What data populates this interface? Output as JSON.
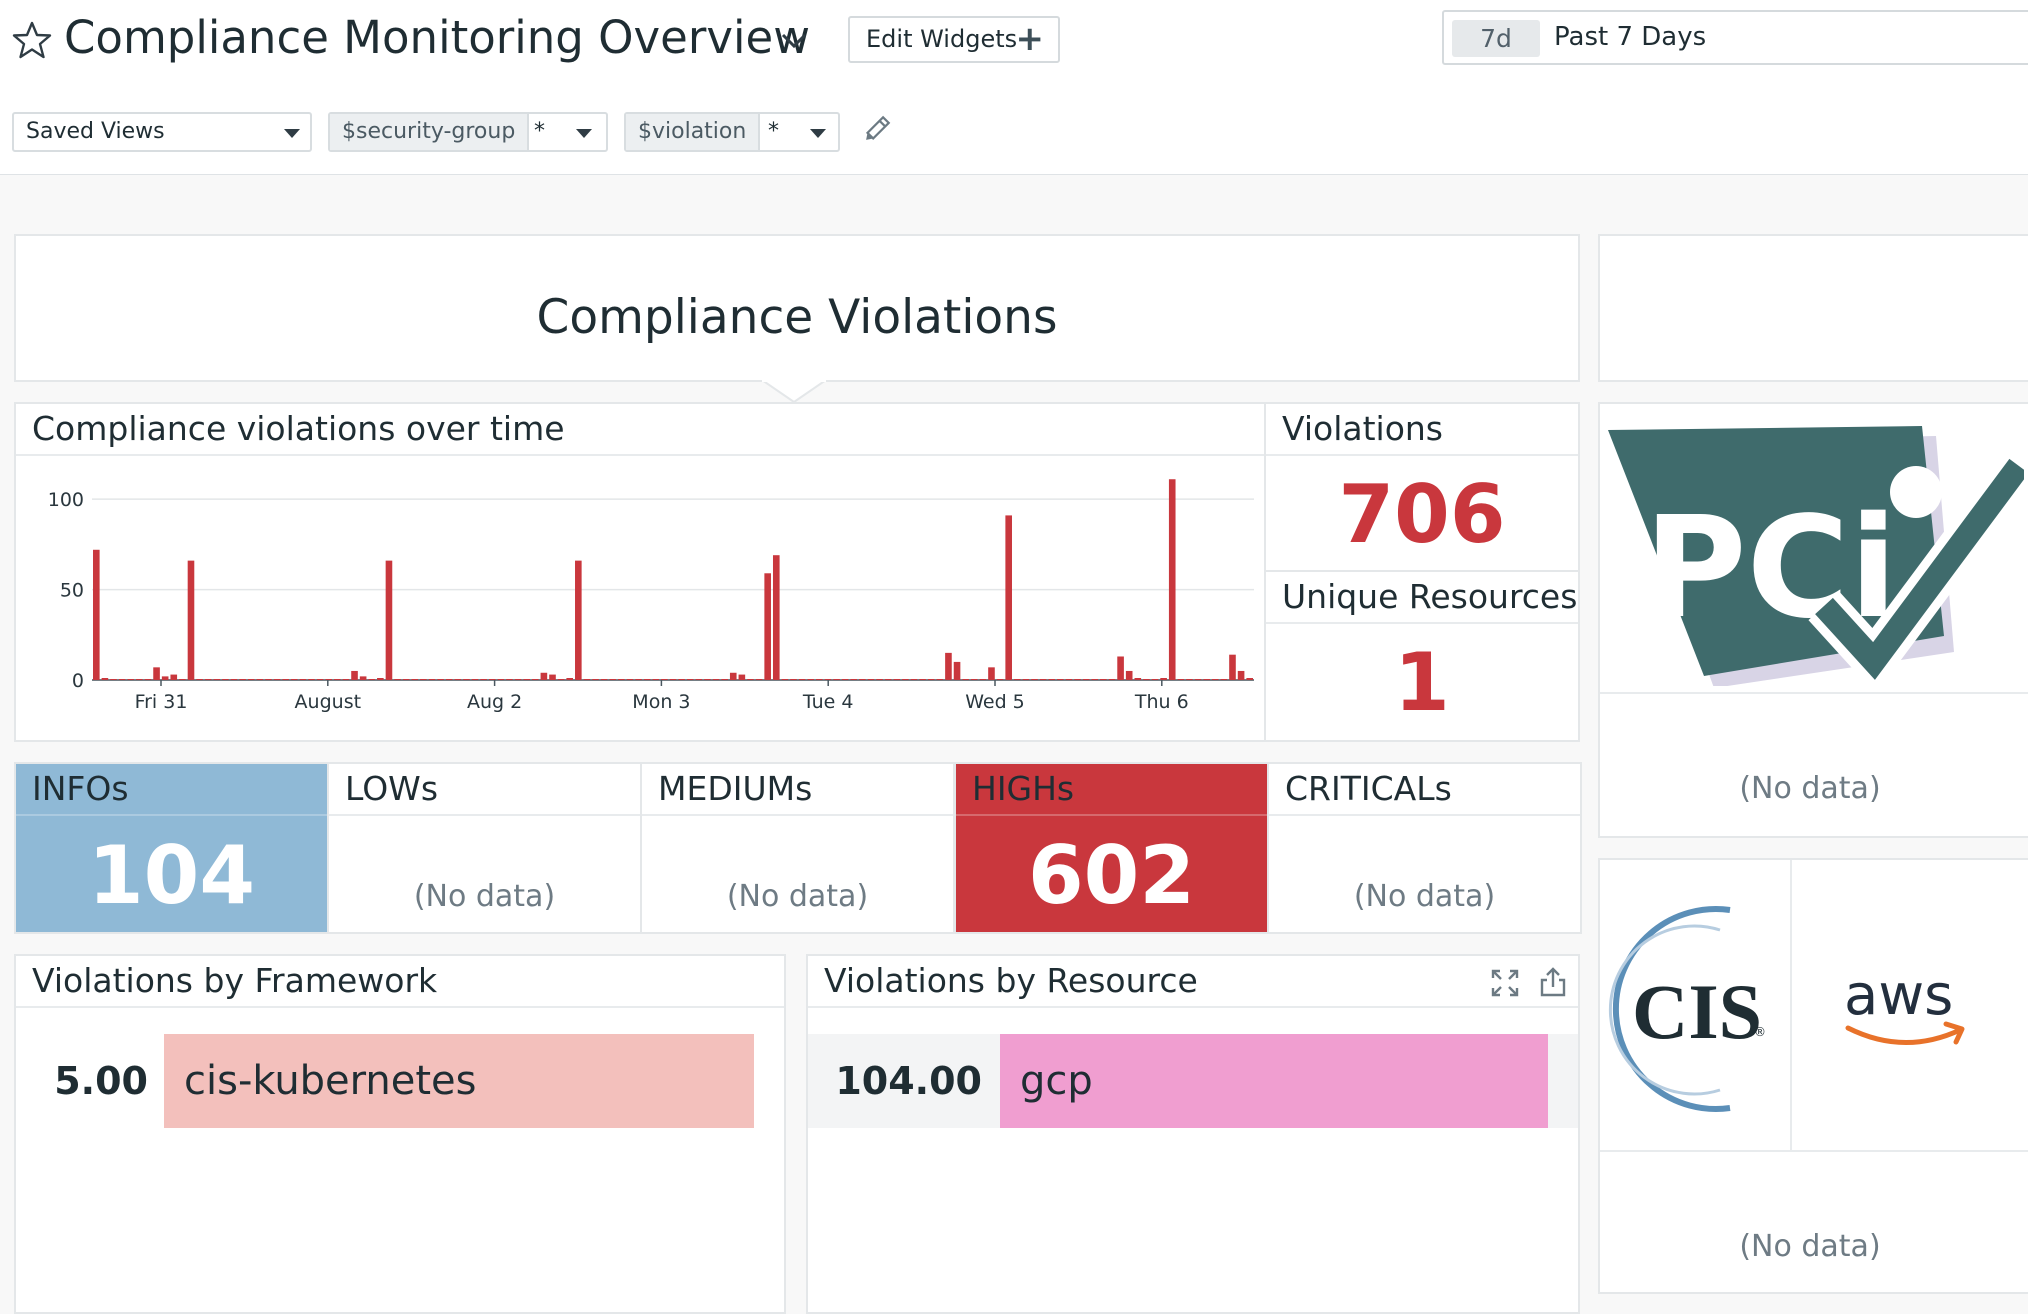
{
  "header": {
    "title": "Compliance Monitoring Overview",
    "edit_widgets": "Edit Widgets",
    "time_badge": "7d",
    "time_label": "Past 7 Days"
  },
  "filters": {
    "saved_views": "Saved Views",
    "vars": [
      {
        "name": "$security-group",
        "value": "*"
      },
      {
        "name": "$violation",
        "value": "*"
      }
    ]
  },
  "group_title": "Compliance Violations",
  "timeseries": {
    "title": "Compliance violations over time"
  },
  "violations": {
    "label": "Violations",
    "value": "706"
  },
  "unique_resources": {
    "label": "Unique Resources",
    "value": "1"
  },
  "severity": [
    {
      "label": "INFOs",
      "value": "104",
      "no_data": "",
      "color": "#8fb9d6"
    },
    {
      "label": "LOWs",
      "value": "",
      "no_data": "(No data)",
      "color": ""
    },
    {
      "label": "MEDIUMs",
      "value": "",
      "no_data": "(No data)",
      "color": ""
    },
    {
      "label": "HIGHs",
      "value": "602",
      "no_data": "",
      "color": "#c9373d"
    },
    {
      "label": "CRITICALs",
      "value": "",
      "no_data": "(No data)",
      "color": ""
    }
  ],
  "by_framework": {
    "title": "Violations by Framework",
    "rows": [
      {
        "value": "5.00",
        "name": "cis-kubernetes",
        "color": "#f3c0bc"
      }
    ]
  },
  "by_resource": {
    "title": "Violations by Resource",
    "rows": [
      {
        "value": "104.00",
        "name": "gcp",
        "color": "#f09ed0"
      }
    ]
  },
  "logos": {
    "pci_text": "PCi",
    "cis_text": "CIS",
    "aws_text": "aws",
    "pci_no_data": "(No data)",
    "cis_no_data": "(No data)"
  },
  "icons": [
    "star-icon",
    "chevron-down-icon",
    "plus-icon",
    "pencil-icon",
    "expand-icon",
    "share-icon"
  ],
  "chart_data": {
    "type": "bar",
    "title": "Compliance violations over time",
    "xlabel": "",
    "ylabel": "",
    "ylim": [
      0,
      115
    ],
    "yticks": [
      0,
      50,
      100
    ],
    "xticks": [
      "Fri 31",
      "August",
      "Aug 2",
      "Mon 3",
      "Tue 4",
      "Wed 5",
      "Thu 6"
    ],
    "color": "#c9373d",
    "grid": true,
    "values": [
      72,
      1,
      0,
      0,
      0,
      0,
      0,
      7,
      2,
      3,
      0,
      66,
      0,
      0,
      0,
      0,
      0,
      0,
      0,
      0,
      0,
      0,
      0,
      0,
      0,
      0,
      0,
      0,
      0,
      0,
      5,
      2,
      0,
      1,
      66,
      0,
      0,
      0,
      0,
      0,
      0,
      0,
      0,
      0,
      0,
      0,
      0,
      0,
      0,
      0,
      0,
      0,
      4,
      3,
      0,
      1,
      66,
      0,
      0,
      0,
      0,
      0,
      0,
      0,
      0,
      0,
      0,
      0,
      0,
      0,
      0,
      0,
      0,
      0,
      4,
      3,
      0,
      0,
      59,
      69,
      0,
      0,
      0,
      0,
      0,
      0,
      0,
      0,
      0,
      0,
      0,
      0,
      0,
      0,
      0,
      0,
      0,
      0,
      0,
      15,
      10,
      0,
      0,
      0,
      7,
      0,
      91,
      0,
      0,
      0,
      0,
      0,
      0,
      0,
      0,
      0,
      0,
      0,
      0,
      13,
      5,
      1,
      0,
      0,
      1,
      111,
      0,
      0,
      0,
      0,
      0,
      0,
      14,
      5,
      1
    ]
  }
}
